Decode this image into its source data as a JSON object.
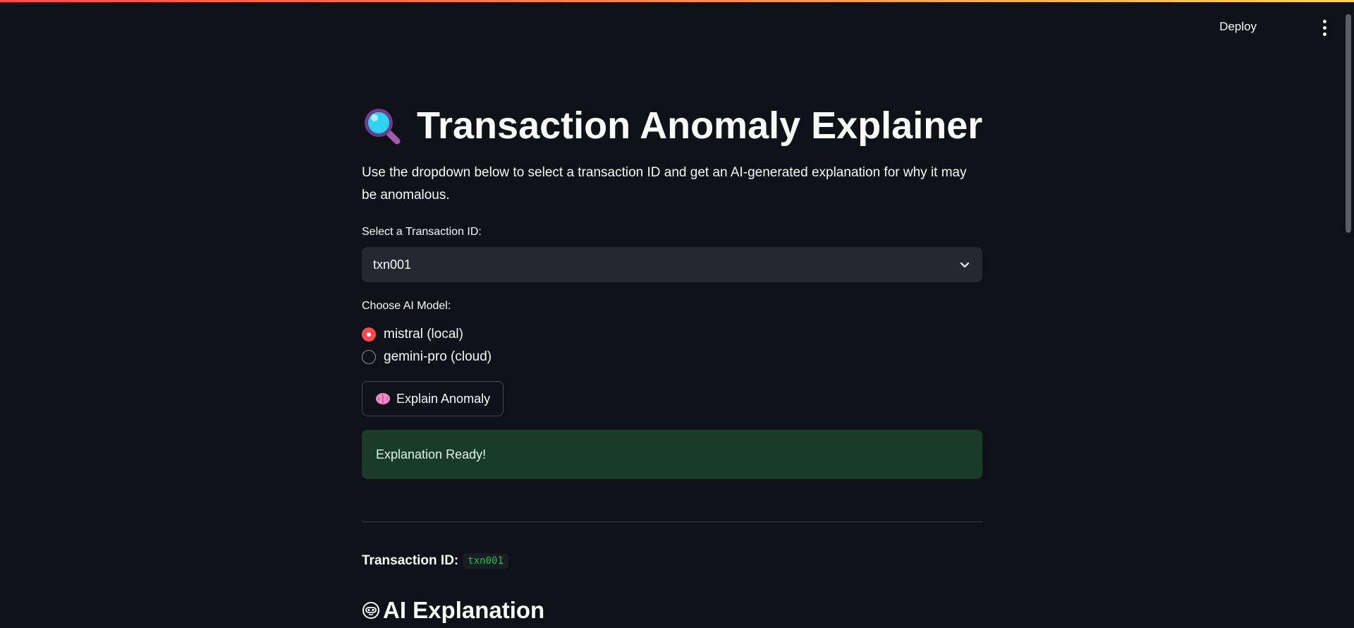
{
  "header": {
    "deploy_label": "Deploy"
  },
  "main": {
    "title": "Transaction Anomaly Explainer",
    "title_icon": "magnifying-glass-icon",
    "intro": "Use the dropdown below to select a transaction ID and get an AI-generated explanation for why it may be anomalous.",
    "select": {
      "label": "Select a Transaction ID:",
      "value": "txn001"
    },
    "model": {
      "label": "Choose AI Model:",
      "options": [
        "mistral (local)",
        "gemini-pro (cloud)"
      ],
      "selected": "mistral (local)"
    },
    "explain_button": "Explain Anomaly",
    "explain_icon": "brain-icon",
    "success_message": "Explanation Ready!",
    "transaction": {
      "label": "Transaction ID:",
      "value": "txn001"
    },
    "ai_heading": "AI Explanation",
    "ai_icon": "robot-icon"
  },
  "colors": {
    "background": "#0e1117",
    "accent": "#ff4b4b",
    "success_bg": "#1b3b29",
    "code_text": "#21c354"
  }
}
